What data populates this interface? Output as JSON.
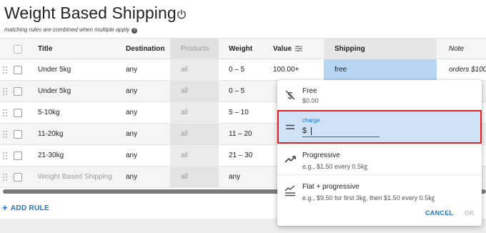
{
  "page": {
    "title": "Weight Based Shipping",
    "subtitle": "matching rules are combined when multiple apply",
    "help_icon": "?"
  },
  "table": {
    "headers": {
      "title": "Title",
      "destination": "Destination",
      "products": "Products",
      "weight": "Weight",
      "value": "Value",
      "shipping": "Shipping",
      "note": "Note"
    },
    "rows": [
      {
        "title": "Under 5kg",
        "destination": "any",
        "products": "all",
        "weight": "0 – 5",
        "value": "100.00+",
        "shipping": "free",
        "note": "orders $100..."
      },
      {
        "title": "Under 5kg",
        "destination": "any",
        "products": "all",
        "weight": "0 – 5",
        "value": "",
        "shipping": "",
        "note": ""
      },
      {
        "title": "5-10kg",
        "destination": "any",
        "products": "all",
        "weight": "5 – 10",
        "value": "",
        "shipping": "",
        "note": ""
      },
      {
        "title": "11-20kg",
        "destination": "any",
        "products": "all",
        "weight": "11 – 20",
        "value": "",
        "shipping": "",
        "note": ""
      },
      {
        "title": "21-30kg",
        "destination": "any",
        "products": "all",
        "weight": "21 – 30",
        "value": "",
        "shipping": "",
        "note": ""
      },
      {
        "title": "Weight Based Shipping",
        "destination": "any",
        "products": "all",
        "weight": "any",
        "value": "",
        "shipping": "",
        "note": ""
      }
    ]
  },
  "add_rule_label": "ADD RULE",
  "popover": {
    "options": [
      {
        "title": "Free",
        "sub": "$0.00"
      },
      {
        "title": "",
        "sub": ""
      },
      {
        "title": "Progressive",
        "sub": "e.g., $1.50 every 0.5㎏"
      },
      {
        "title": "Flat + progressive",
        "sub": "e.g., $9.50 for first 3㎏, then $1.50 every 0.5㎏"
      }
    ],
    "charge": {
      "label": "charge",
      "currency": "$",
      "value": ""
    },
    "cancel_label": "CANCEL",
    "ok_label": "OK"
  },
  "colors": {
    "accent": "#1a73c8",
    "selected_cell": "#b7d6f4",
    "highlight_border": "#e01f26"
  }
}
